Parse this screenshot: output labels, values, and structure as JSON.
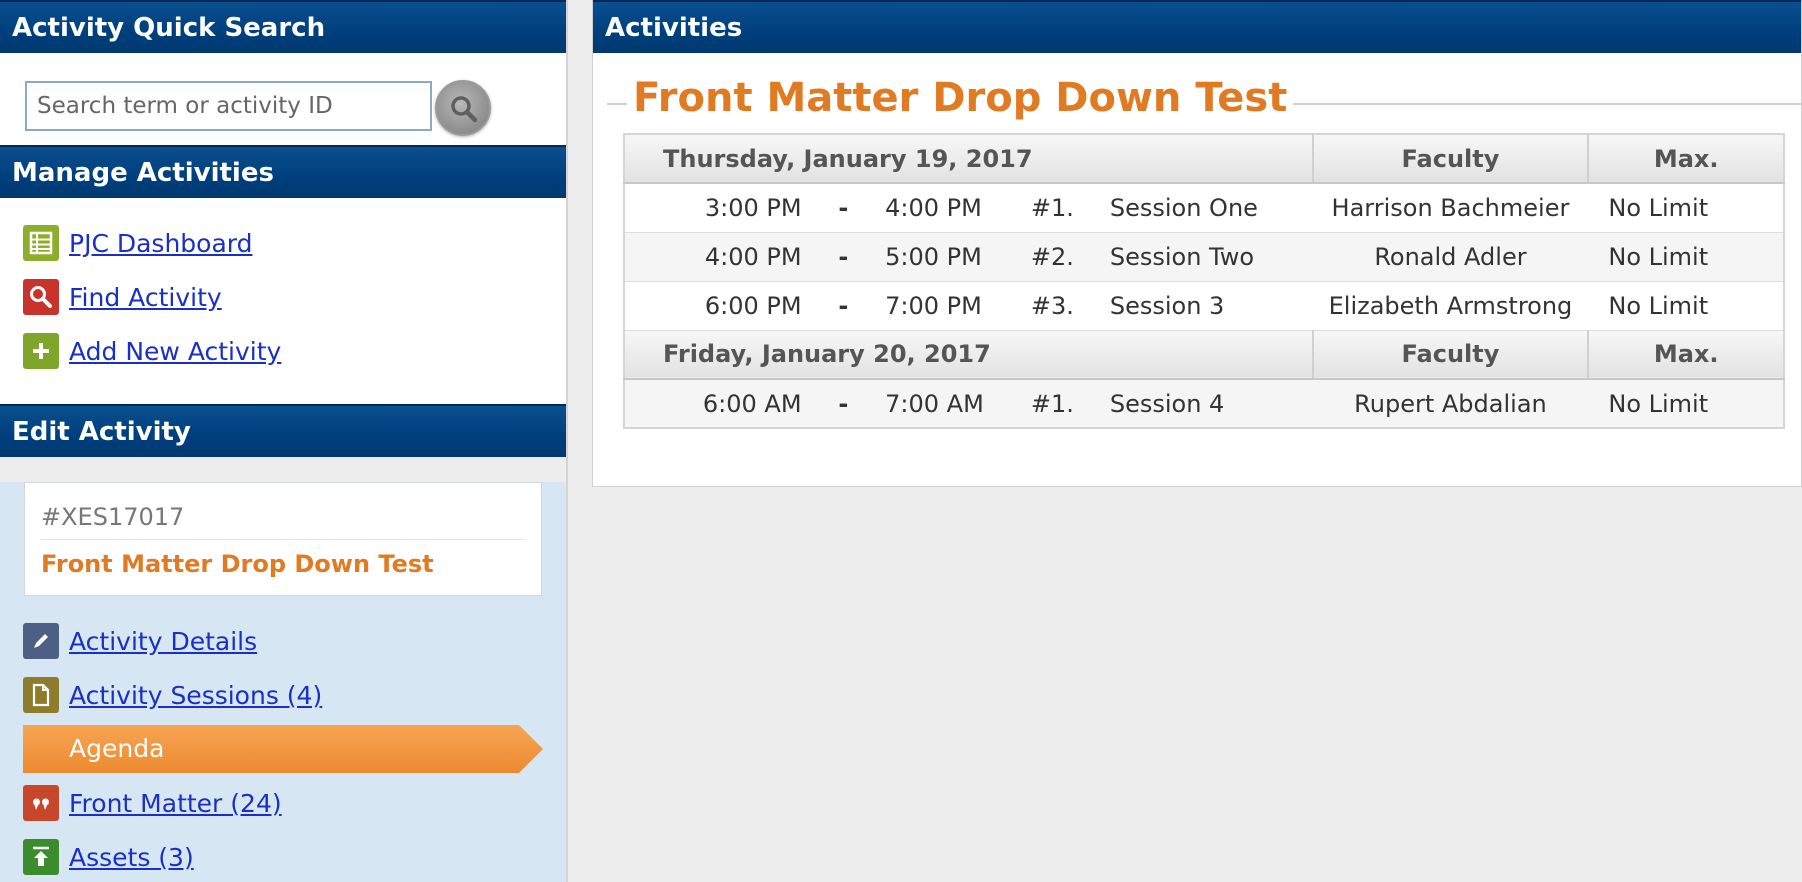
{
  "sidebar": {
    "quick_search": {
      "title": "Activity Quick Search",
      "placeholder": "Search term or activity ID"
    },
    "manage": {
      "title": "Manage Activities",
      "links": [
        {
          "label": "PJC Dashboard",
          "icon": "table-icon",
          "color": "#8dae2a"
        },
        {
          "label": "Find Activity",
          "icon": "magnifier-icon",
          "color": "#c8332c"
        },
        {
          "label": "Add New Activity",
          "icon": "plus-icon",
          "color": "#7fa52b"
        }
      ]
    },
    "edit": {
      "title": "Edit Activity",
      "activity_id": "#XES17017",
      "activity_name": "Front Matter Drop Down Test",
      "links": [
        {
          "label": "Activity Details",
          "icon": "pencil-icon",
          "color": "#4c5f85"
        },
        {
          "label": "Activity Sessions (4)",
          "icon": "document-icon",
          "color": "#8c7c2c"
        },
        {
          "label": "Agenda",
          "icon": "",
          "active": true
        },
        {
          "label": "Front Matter (24)",
          "icon": "quote-icon",
          "color": "#c8472a"
        },
        {
          "label": "Assets (3)",
          "icon": "upload-icon",
          "color": "#3a8c2c"
        }
      ]
    }
  },
  "main": {
    "title": "Activities",
    "page_title": "Front Matter Drop Down Test",
    "columns": {
      "faculty": "Faculty",
      "max": "Max."
    },
    "days": [
      {
        "date": "Thursday, January 19, 2017",
        "sessions": [
          {
            "start": "3:00 PM",
            "dash": "-",
            "end": "4:00 PM",
            "num": "#1.",
            "name": "Session One",
            "faculty": "Harrison Bachmeier",
            "max": "No Limit"
          },
          {
            "start": "4:00 PM",
            "dash": "-",
            "end": "5:00 PM",
            "num": "#2.",
            "name": "Session Two",
            "faculty": "Ronald Adler",
            "max": "No Limit"
          },
          {
            "start": "6:00 PM",
            "dash": "-",
            "end": "7:00 PM",
            "num": "#3.",
            "name": "Session 3",
            "faculty": "Elizabeth Armstrong",
            "max": "No Limit"
          }
        ]
      },
      {
        "date": "Friday, January 20, 2017",
        "sessions": [
          {
            "start": "6:00 AM",
            "dash": "-",
            "end": "7:00 AM",
            "num": "#1.",
            "name": "Session 4",
            "faculty": "Rupert Abdalian",
            "max": "No Limit"
          }
        ]
      }
    ]
  },
  "colors": {
    "header_blue": "#003f7d",
    "accent_orange": "#e07a23",
    "link_blue": "#1a2fc6",
    "edit_panel_bg": "#d6e6f3"
  }
}
